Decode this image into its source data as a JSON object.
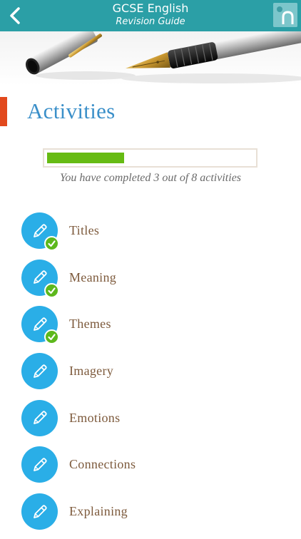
{
  "header": {
    "title": "GCSE English",
    "subtitle": "Revision Guide",
    "back_icon": "chevron-left-icon",
    "logo_icon": "app-logo-icon"
  },
  "page": {
    "title": "Activities",
    "accent_color": "#e2491d",
    "title_color": "#3a8fc9"
  },
  "progress": {
    "completed": 3,
    "total": 8,
    "fraction": 0.375,
    "text": "You have completed 3 out of 8 activities",
    "fill_color": "#66bb13"
  },
  "activities": [
    {
      "label": "Titles",
      "completed": true,
      "icon": "pencil-icon"
    },
    {
      "label": "Meaning",
      "completed": true,
      "icon": "pencil-icon"
    },
    {
      "label": "Themes",
      "completed": true,
      "icon": "pencil-icon"
    },
    {
      "label": "Imagery",
      "completed": false,
      "icon": "pencil-icon"
    },
    {
      "label": "Emotions",
      "completed": false,
      "icon": "pencil-icon"
    },
    {
      "label": "Connections",
      "completed": false,
      "icon": "pencil-icon"
    },
    {
      "label": "Explaining",
      "completed": false,
      "icon": "pencil-icon"
    }
  ],
  "colors": {
    "header_bg": "#2b9fa6",
    "icon_bg": "#2aaee7",
    "check_bg": "#5db81c",
    "label_color": "#7d5a3c"
  }
}
